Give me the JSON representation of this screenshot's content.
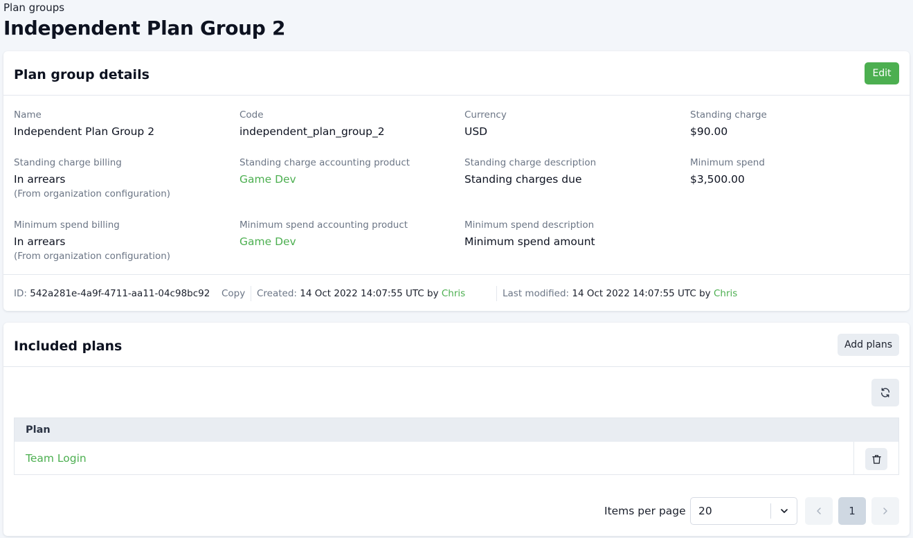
{
  "breadcrumb": "Plan groups",
  "page_title": "Independent Plan Group 2",
  "details": {
    "title": "Plan group details",
    "edit_label": "Edit",
    "fields": {
      "name": {
        "label": "Name",
        "value": "Independent Plan Group 2"
      },
      "code": {
        "label": "Code",
        "value": "independent_plan_group_2"
      },
      "currency": {
        "label": "Currency",
        "value": "USD"
      },
      "standing_charge": {
        "label": "Standing charge",
        "value": "$90.00"
      },
      "sc_billing": {
        "label": "Standing charge billing",
        "value": "In arrears",
        "note": "(From organization configuration)"
      },
      "sc_product": {
        "label": "Standing charge accounting product",
        "value": "Game Dev"
      },
      "sc_description": {
        "label": "Standing charge description",
        "value": "Standing charges due"
      },
      "min_spend": {
        "label": "Minimum spend",
        "value": "$3,500.00"
      },
      "ms_billing": {
        "label": "Minimum spend billing",
        "value": "In arrears",
        "note": "(From organization configuration)"
      },
      "ms_product": {
        "label": "Minimum spend accounting product",
        "value": "Game Dev"
      },
      "ms_description": {
        "label": "Minimum spend description",
        "value": "Minimum spend amount"
      }
    },
    "meta": {
      "id_label": "ID:",
      "id_value": "542a281e-4a9f-4711-aa11-04c98bc92",
      "copy_label": "Copy",
      "created_label": "Created:",
      "created_value": "14 Oct 2022 14:07:55 UTC by",
      "created_by": "Chris",
      "modified_label": "Last modified:",
      "modified_value": "14 Oct 2022 14:07:55 UTC by",
      "modified_by": "Chris"
    }
  },
  "included": {
    "title": "Included plans",
    "add_label": "Add plans",
    "table": {
      "header": "Plan",
      "rows": [
        {
          "plan": "Team Login"
        }
      ]
    },
    "pagination": {
      "items_per_page_label": "Items per page",
      "items_per_page_value": "20",
      "current_page": "1"
    }
  },
  "colors": {
    "accent": "#4caf50",
    "muted": "#6b7585"
  },
  "icons": {
    "refresh": "refresh-icon",
    "delete": "trash-icon",
    "dropdown": "chevron-down-icon",
    "prev": "chevron-left-icon",
    "next": "chevron-right-icon"
  }
}
